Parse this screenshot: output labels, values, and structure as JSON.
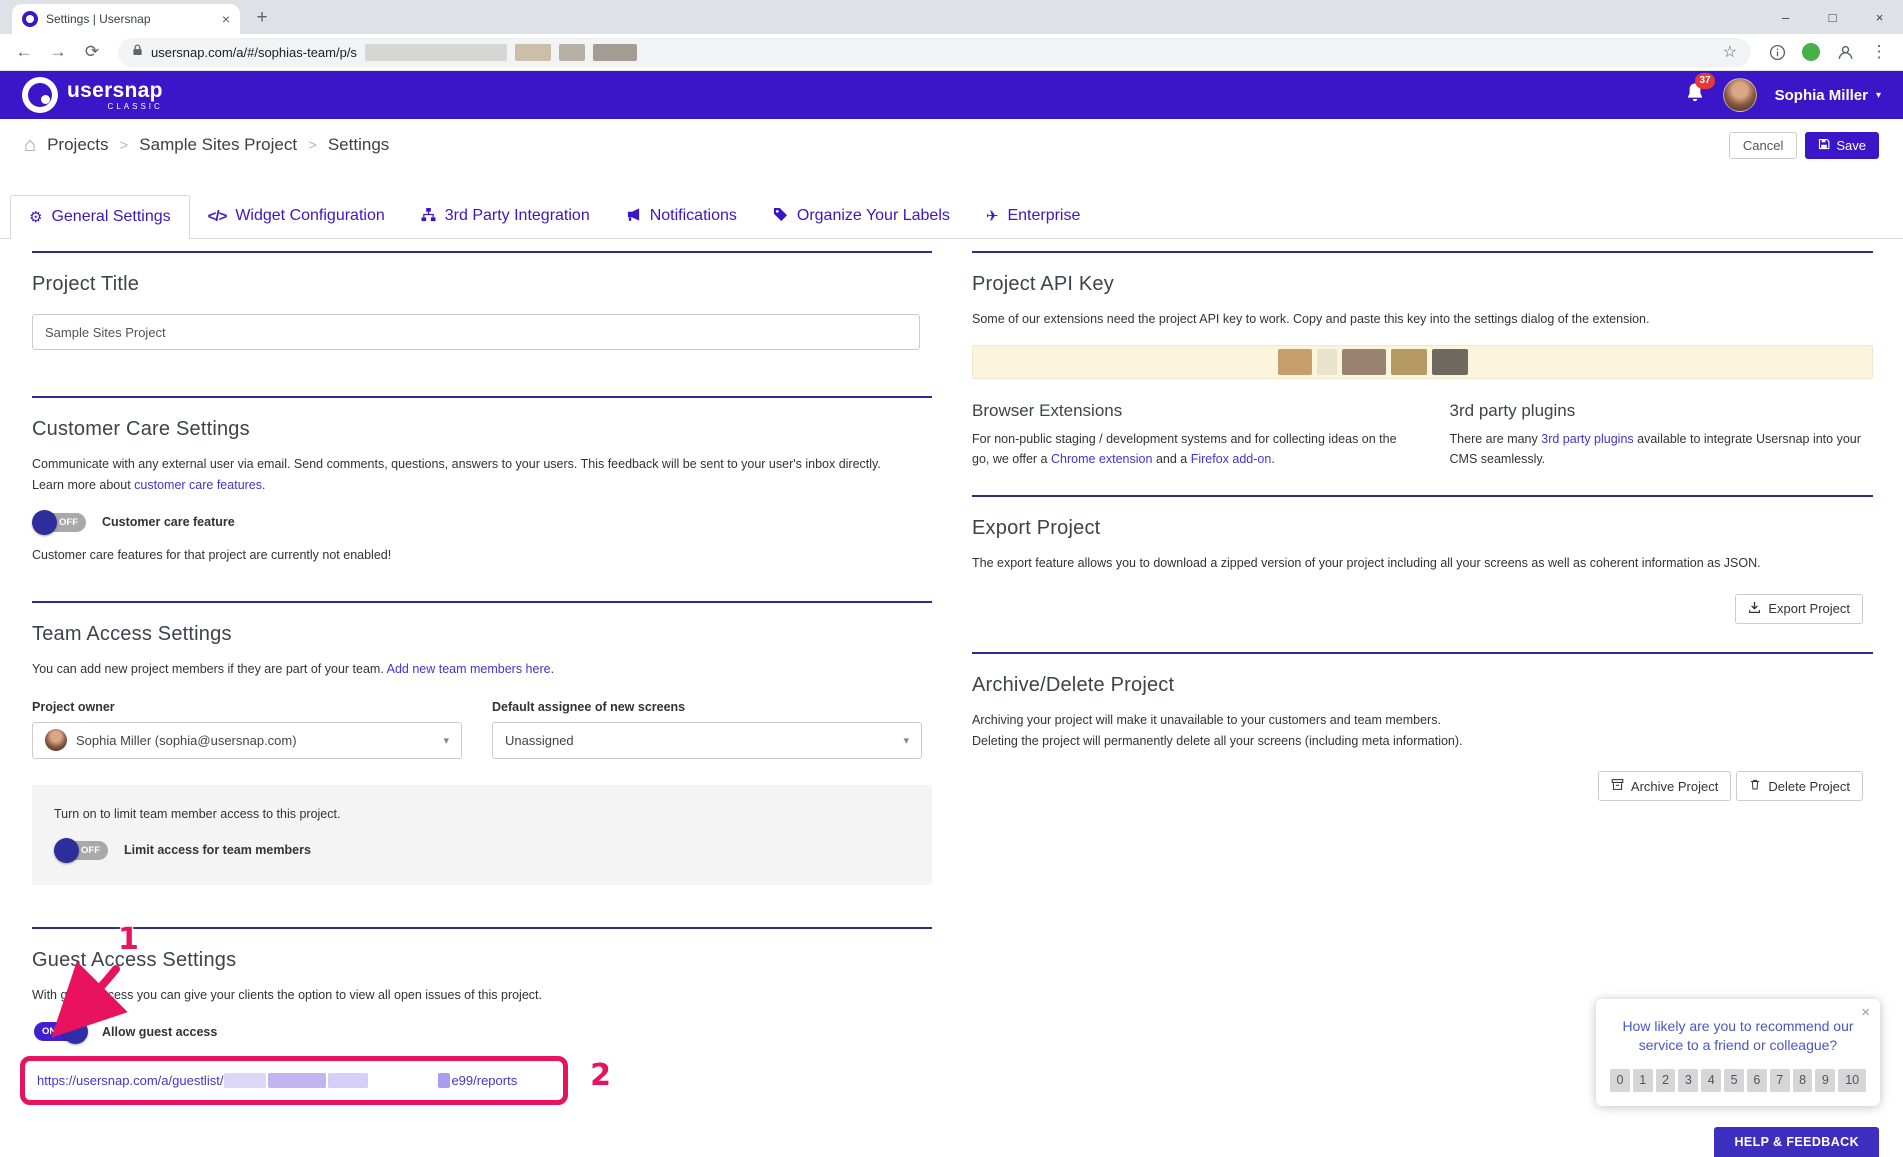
{
  "colors": {
    "accent": "#3b16c9",
    "accent_dark": "#2d2d9b",
    "link": "#4433d1",
    "section_border": "#2f2c8e",
    "annotation": "#e8125e",
    "help": "#3e2ec0",
    "nps_text": "#4a55c8",
    "badge": "#e53935"
  },
  "icons": {
    "minimize": "–",
    "maximize": "□",
    "close": "×",
    "tab_close": "×",
    "new_tab": "+",
    "back": "←",
    "forward": "→",
    "refresh": "⟳",
    "star": "☆",
    "menu": "⋮",
    "home": "⌂",
    "chevron": ">",
    "caret": "▾",
    "gear": "⚙",
    "code": "</>",
    "plane": "✈"
  },
  "browser": {
    "tab_title": "Settings | Usersnap",
    "url_visible": "usersnap.com/a/#/sophias-team/p/s"
  },
  "header": {
    "logo_text": "usersnap",
    "logo_subtext": "CLASSIC",
    "notification_badge": "37",
    "user_name": "Sophia Miller"
  },
  "breadcrumb": {
    "items": [
      "Projects",
      "Sample Sites Project",
      "Settings"
    ]
  },
  "toolbar": {
    "cancel_label": "Cancel",
    "save_label": "Save"
  },
  "tabs": [
    "General Settings",
    "Widget Configuration",
    "3rd Party Integration",
    "Notifications",
    "Organize Your Labels",
    "Enterprise"
  ],
  "project_title": {
    "heading": "Project Title",
    "value": "Sample Sites Project"
  },
  "customer_care": {
    "heading": "Customer Care Settings",
    "description": "Communicate with any external user via email. Send comments, questions, answers to your users. This feedback will be sent to your user's inbox directly.",
    "learn_more_prefix": "Learn more about",
    "learn_more_link": "customer care features",
    "learn_more_suffix": ".",
    "toggle_state": "OFF",
    "toggle_label": "Customer care feature",
    "note": "Customer care features for that project are currently not enabled!"
  },
  "team_access": {
    "heading": "Team Access Settings",
    "description": "You can add new project members if they are part of your team.",
    "add_members_link": "Add new team members here",
    "after_link": ".",
    "owner_label": "Project owner",
    "owner_value": "Sophia Miller (sophia@usersnap.com)",
    "assignee_label": "Default assignee of new screens",
    "assignee_value": "Unassigned",
    "limit_text": "Turn on to limit team member access to this project.",
    "limit_toggle_state": "OFF",
    "limit_toggle_label": "Limit access for team members"
  },
  "guest_access": {
    "heading": "Guest Access Settings",
    "description": "With guest access you can give your clients the option to view all open issues of this project.",
    "toggle_state": "ON",
    "toggle_label": "Allow guest access",
    "url_prefix": "https://usersnap.com/a/guestlist/",
    "url_suffix": "e99/reports"
  },
  "api_key": {
    "heading": "Project API Key",
    "description": "Some of our extensions need the project API key to work. Copy and paste this key into the settings dialog of the extension.",
    "browser_ext_heading": "Browser Extensions",
    "browser_ext_text_1": "For non-public staging / development systems and for collecting ideas on the go, we offer a",
    "chrome_link": "Chrome extension",
    "browser_ext_text_2": "and a",
    "firefox_link": "Firefox add-on",
    "browser_ext_text_3": ".",
    "plugins_heading": "3rd party plugins",
    "plugins_text_1": "There are many",
    "plugins_link": "3rd party plugins",
    "plugins_text_2": "available to integrate Usersnap into your CMS seamlessly."
  },
  "export_project": {
    "heading": "Export Project",
    "description": "The export feature allows you to download a zipped version of your project including all your screens as well as coherent information as JSON.",
    "button": "Export Project"
  },
  "archive_delete": {
    "heading": "Archive/Delete Project",
    "line1": "Archiving your project will make it unavailable to your customers and team members.",
    "line2": "Deleting the project will permanently delete all your screens (including meta information).",
    "archive_button": "Archive Project",
    "delete_button": "Delete Project"
  },
  "nps": {
    "question": "How likely are you to recommend our service to a friend or colleague?",
    "ratings": [
      "0",
      "1",
      "2",
      "3",
      "4",
      "5",
      "6",
      "7",
      "8",
      "9",
      "10"
    ]
  },
  "help_button": "HELP & FEEDBACK",
  "annotations": {
    "step1": "1",
    "step2": "2"
  }
}
